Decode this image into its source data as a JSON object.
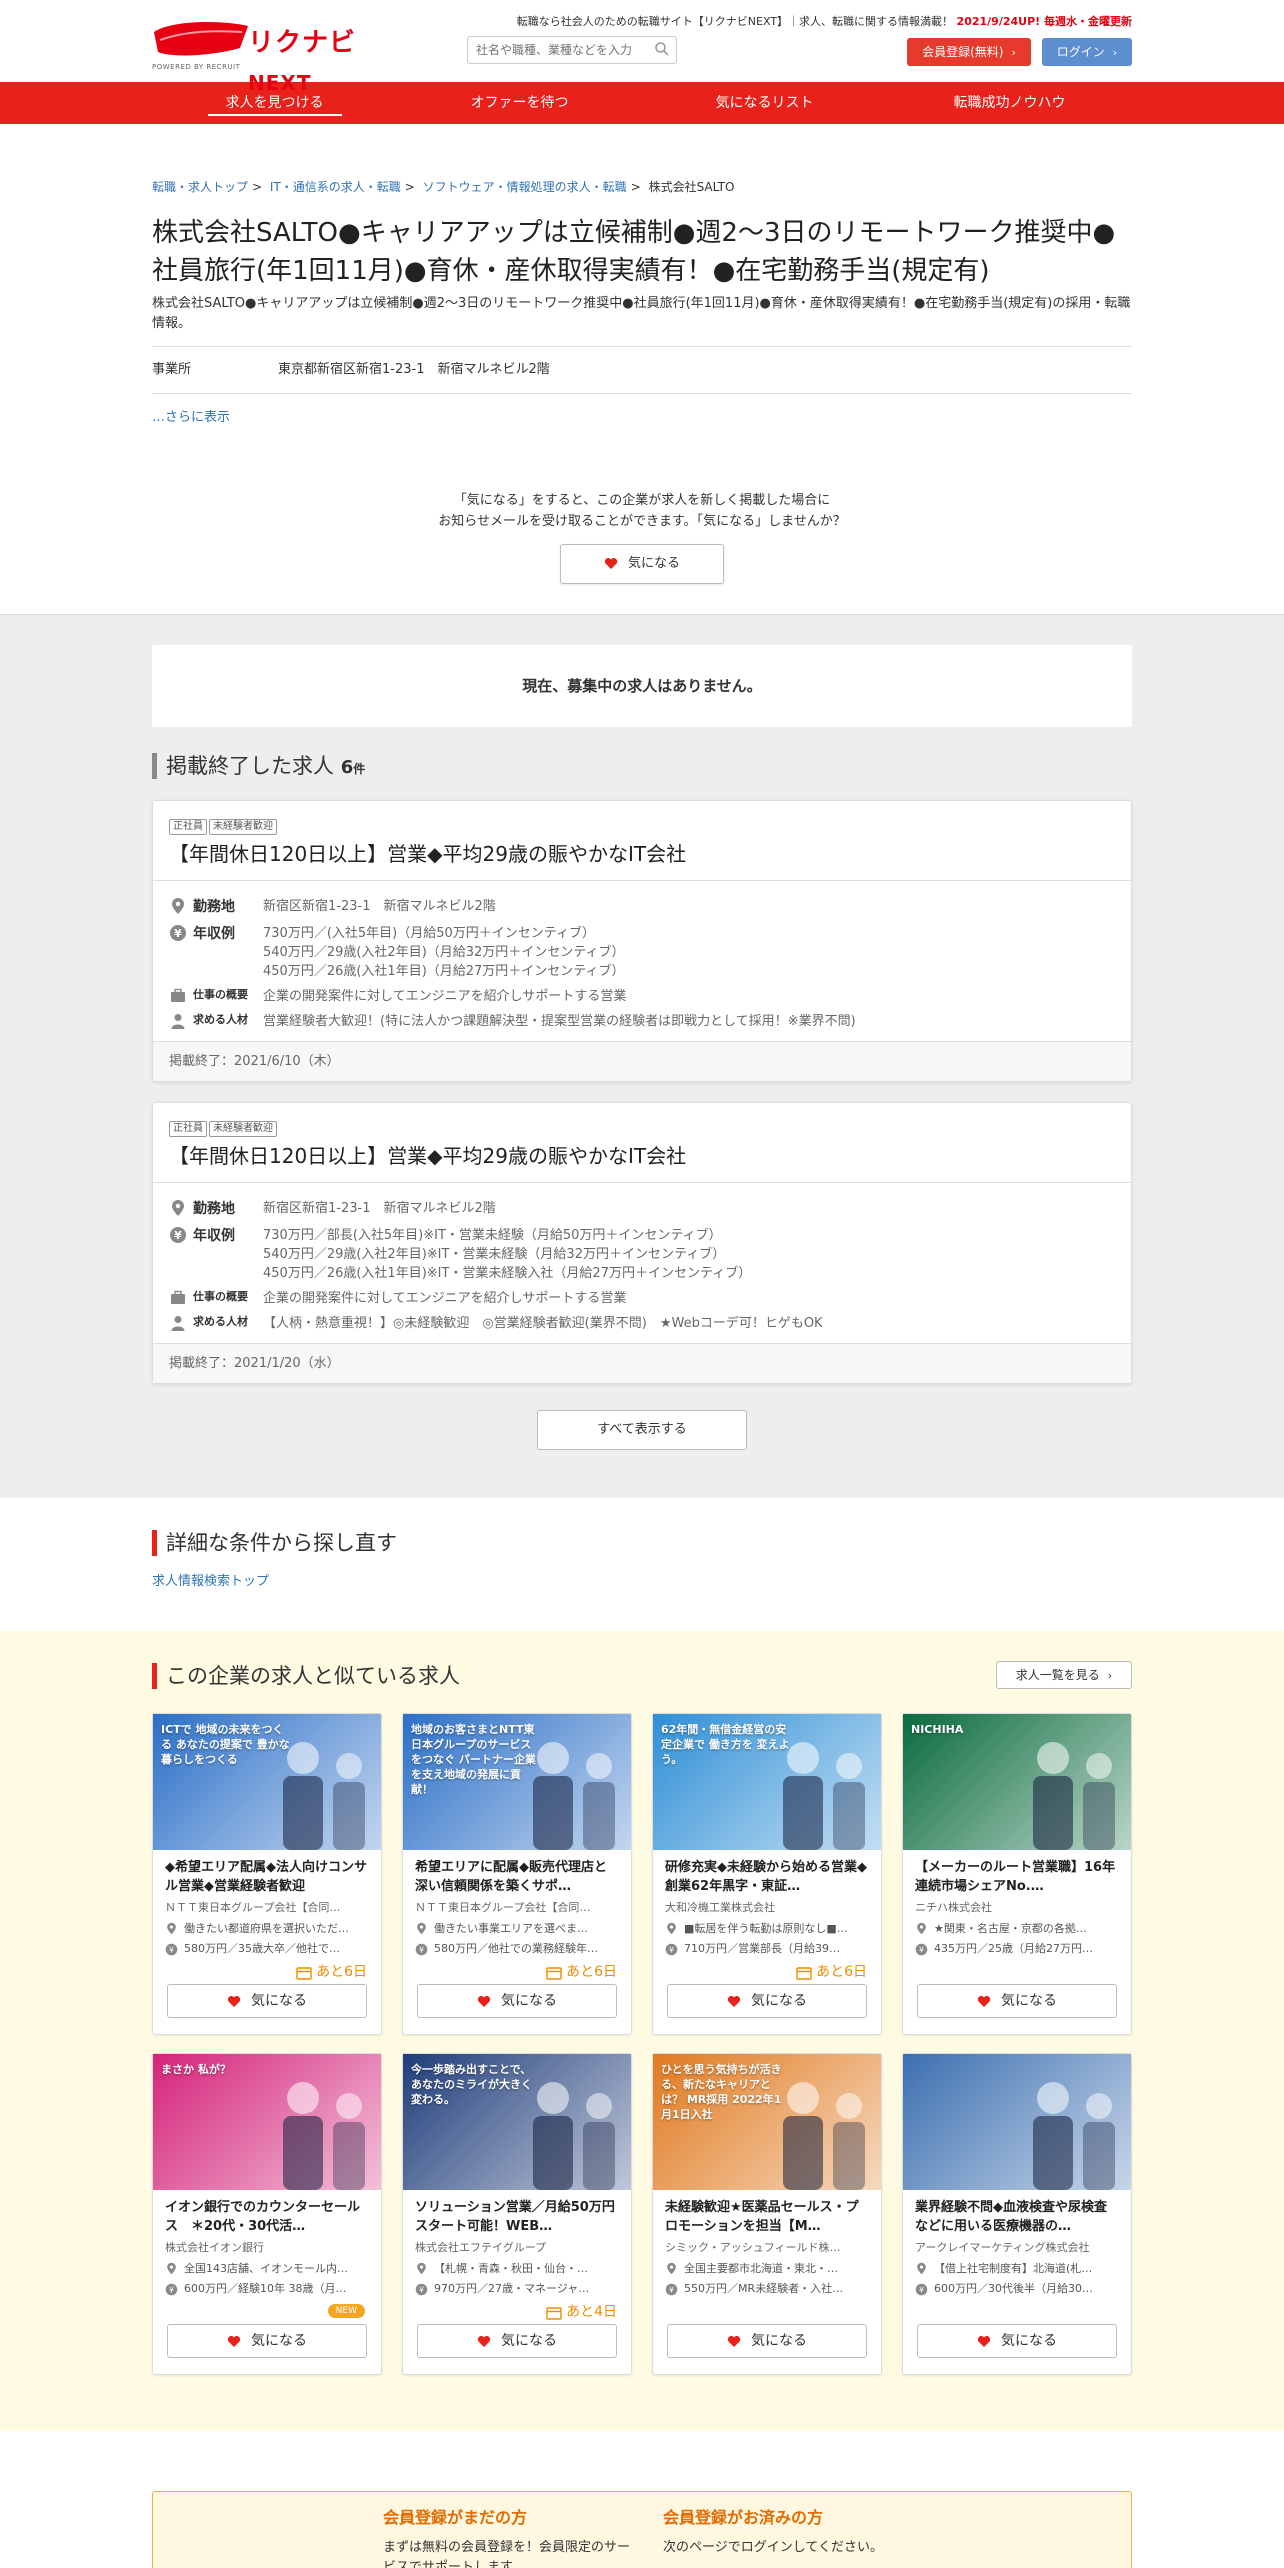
{
  "header": {
    "top_text": "転職なら社会人のための転職サイト【リクナビNEXT】｜求人、転職に関する情報満載！",
    "update_text": "2021/9/24UP! 毎週水・金曜更新",
    "logo_main": "リクナビ",
    "logo_next": "NEXT",
    "logo_sub": "POWERED BY RECRUIT",
    "search_placeholder": "社名や職種、業種などを入力",
    "member_btn": "会員登録(無料)",
    "login_btn": "ログイン"
  },
  "nav": [
    "求人を見つける",
    "オファーを待つ",
    "気になるリスト",
    "転職成功ノウハウ"
  ],
  "breadcrumb": [
    "転職・求人トップ",
    "IT・通信系の求人・転職",
    "ソフトウェア・情報処理の求人・転職",
    "株式会社SALTO"
  ],
  "company": {
    "title": "株式会社SALTO●キャリアアップは立候補制●週2～3日のリモートワーク推奨中●社員旅行(年1回11月)●育休・産休取得実績有！●在宅勤務手当(規定有)",
    "desc": "株式会社SALTO●キャリアアップは立候補制●週2～3日のリモートワーク推奨中●社員旅行(年1回11月)●育休・産休取得実績有！●在宅勤務手当(規定有)の採用・転職情報。",
    "office_label": "事業所",
    "office_value": "東京都新宿区新宿1-23-1　新宿マルネビル2階",
    "more": "…さらに表示"
  },
  "favorite": {
    "line1": "「気になる」をすると、この企業が求人を新しく掲載した場合に",
    "line2": "お知らせメールを受け取ることができます。「気になる」しませんか？",
    "button": "気になる"
  },
  "no_jobs": "現在、募集中の求人はありません。",
  "ended": {
    "heading": "掲載終了した求人",
    "count": "6",
    "unit": "件",
    "show_all": "すべて表示する",
    "labels": {
      "location": "勤務地",
      "salary": "年収例",
      "summary": "仕事の概要",
      "wanted": "求める人材"
    },
    "jobs": [
      {
        "tags": [
          "正社員",
          "未経験者歓迎"
        ],
        "title": "【年間休日120日以上】営業◆平均29歳の賑やかなIT会社",
        "location": "新宿区新宿1-23-1　新宿マルネビル2階",
        "salary": [
          "730万円／(入社5年目)（月給50万円＋インセンティブ）",
          "540万円／29歳(入社2年目)（月給32万円＋インセンティブ）",
          "450万円／26歳(入社1年目)（月給27万円＋インセンティブ）"
        ],
        "summary": "企業の開発案件に対してエンジニアを紹介しサポートする営業",
        "wanted": "営業経験者大歓迎！(特に法人かつ課題解決型・提案型営業の経験者は即戦力として採用！※業界不問)",
        "ended": "掲載終了：2021/6/10（木）"
      },
      {
        "tags": [
          "正社員",
          "未経験者歓迎"
        ],
        "title": "【年間休日120日以上】営業◆平均29歳の賑やかなIT会社",
        "location": "新宿区新宿1-23-1　新宿マルネビル2階",
        "salary": [
          "730万円／部長(入社5年目)※IT・営業未経験（月給50万円＋インセンティブ）",
          "540万円／29歳(入社2年目)※IT・営業未経験（月給32万円＋インセンティブ）",
          "450万円／26歳(入社1年目)※IT・営業未経験入社（月給27万円＋インセンティブ）"
        ],
        "summary": "企業の開発案件に対してエンジニアを紹介しサポートする営業",
        "wanted": "【人柄・熱意重視！】◎未経験歓迎　◎営業経験者歓迎(業界不問)　★Webコーデ可！ヒゲもOK",
        "ended": "掲載終了：2021/1/20（水）"
      }
    ]
  },
  "search_again": {
    "heading": "詳細な条件から探し直す",
    "link": "求人情報検索トップ"
  },
  "similar": {
    "heading": "この企業の求人と似ている求人",
    "list_btn": "求人一覧を見る",
    "fav": "気になる",
    "cards": [
      {
        "title": "◆希望エリア配属◆法人向けコンサル営業◆営業経験者歓迎",
        "company": "ＮＴＴ東日本グループ会社【合同…",
        "location": "働きたい都道府県を選択いただ…",
        "salary": "580万円／35歳大卒／他社で…",
        "badge": "あと6日",
        "img_text": "ICTで 地域の未来をつくる あなたの提案で 豊かな暮らしをつくる",
        "theme": "#2b6fc7"
      },
      {
        "title": "希望エリアに配属◆販売代理店と深い信頼関係を築くサポ…",
        "company": "ＮＴＴ東日本グループ会社【合同…",
        "location": "働きたい事業エリアを選べま…",
        "salary": "580万円／他社での業務経験年…",
        "badge": "あと6日",
        "img_text": "地域のお客さまとNTT東日本グループのサービスをつなぐ パートナー企業を支え地域の発展に貢献！",
        "theme": "#2b6fc7"
      },
      {
        "title": "研修充実◆未経験から始める営業◆創業62年黒字・東証…",
        "company": "大和冷機工業株式会社",
        "location": "■転居を伴う転勤は原則なし■…",
        "salary": "710万円／営業部長（月給39…",
        "badge": "あと6日",
        "img_text": "62年間・無借金経営の安定企業で 働き方を 変えよう。",
        "theme": "#2e8fd6"
      },
      {
        "title": "【メーカーのルート営業職】16年連続市場シェアNo.…",
        "company": "ニチハ株式会社",
        "location": "★関東・名古屋・京都の各拠…",
        "salary": "435万円／25歳（月給27万円…",
        "badge": "",
        "img_text": "NICHIHA",
        "theme": "#0a6b3e"
      },
      {
        "title": "イオン銀行でのカウンターセールス　＊20代・30代活…",
        "company": "株式会社イオン銀行",
        "location": "全国143店舗、イオンモール内…",
        "salary": "600万円／経験10年 38歳（月…",
        "badge": "NEW",
        "img_text": "まさか 私が？",
        "theme": "#d4237a"
      },
      {
        "title": "ソリューション営業／月給50万円スタート可能！WEB…",
        "company": "株式会社エフテイグループ",
        "location": "【札幌・青森・秋田・仙台・…",
        "salary": "970万円／27歳・マネージャ…",
        "badge": "あと4日",
        "img_text": "今一歩踏み出すことで、あなたのミライが大きく変わる。",
        "theme": "#1f3d7a"
      },
      {
        "title": "未経験歓迎★医薬品セールス・プロモーションを担当【M…",
        "company": "シミック・アッシュフィールド株…",
        "location": "全国主要都市北海道・東北・…",
        "salary": "550万円／MR未経験者・入社…",
        "badge": "",
        "img_text": "ひとを思う気持ちが活きる、新たなキャリアとは？ MR採用 2022年1月1日入社",
        "theme": "#e07a1f"
      },
      {
        "title": "業界経験不問◆血液検査や尿検査などに用いる医療機器の…",
        "company": "アークレイマーケティング株式会社",
        "location": "【借上社宅制度有】北海道(札…",
        "salary": "600万円／30代後半（月給30…",
        "badge": "",
        "img_text": "",
        "theme": "#3b6fb0"
      }
    ]
  },
  "member": {
    "new_h": "会員登録がまだの方",
    "new_p": "まずは無料の会員登録を！会員限定のサービスでサポートします。",
    "done_h": "会員登録がお済みの方",
    "done_p": "次のページでログインしてください。"
  },
  "colors": {
    "brand_red": "#e8221b",
    "link": "#2f73b8",
    "countdown": "#f08c00"
  }
}
